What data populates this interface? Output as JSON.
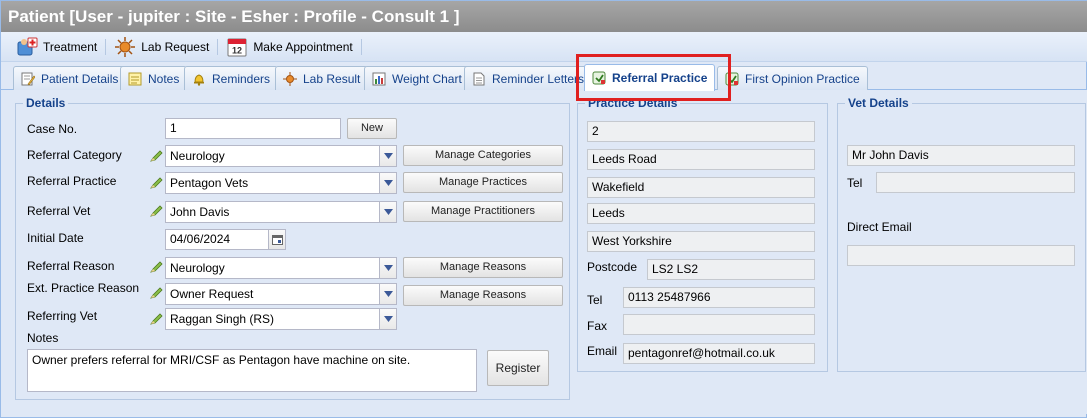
{
  "window": {
    "title": "Patient [User - jupiter : Site - Esher : Profile - Consult 1 ]"
  },
  "toolbar": {
    "treatment_label": "Treatment",
    "lab_request_label": "Lab Request",
    "make_appointment_label": "Make Appointment",
    "calendar_day": "12"
  },
  "tabs": {
    "patient_details": "Patient Details",
    "notes": "Notes",
    "reminders": "Reminders",
    "lab_result": "Lab Result",
    "weight_chart": "Weight Chart",
    "reminder_letters": "Reminder Letters",
    "referral_practice": "Referral Practice",
    "first_opinion_practice": "First Opinion Practice"
  },
  "details": {
    "legend": "Details",
    "case_no_label": "Case No.",
    "case_no_value": "1",
    "new_button": "New",
    "referral_category_label": "Referral Category",
    "referral_category_value": "Neurology",
    "manage_categories_button": "Manage Categories",
    "referral_practice_label": "Referral Practice",
    "referral_practice_value": "Pentagon Vets",
    "manage_practices_button": "Manage Practices",
    "referral_vet_label": "Referral Vet",
    "referral_vet_value": "John Davis",
    "manage_practitioners_button": "Manage Practitioners",
    "initial_date_label": "Initial Date",
    "initial_date_value": "04/06/2024",
    "referral_reason_label": "Referral Reason",
    "referral_reason_value": "Neurology",
    "manage_reasons_button_1": "Manage Reasons",
    "ext_practice_reason_label": "Ext. Practice Reason",
    "ext_practice_reason_value": "Owner Request",
    "manage_reasons_button_2": "Manage Reasons",
    "referring_vet_label": "Referring Vet",
    "referring_vet_value": "Raggan Singh (RS)",
    "notes_label": "Notes",
    "notes_value": "Owner prefers referral for MRI/CSF as Pentagon have machine on site.",
    "register_button": "Register"
  },
  "practice_details": {
    "legend": "Practice Details",
    "address_line1": "2",
    "address_line2": "Leeds Road",
    "address_line3": "Wakefield",
    "address_line4": "Leeds",
    "address_line5": "West Yorkshire",
    "postcode_label": "Postcode",
    "postcode_value": "LS2 LS2",
    "tel_label": "Tel",
    "tel_value": "0113 25487966",
    "fax_label": "Fax",
    "fax_value": "",
    "email_label": "Email",
    "email_value": "pentagonref@hotmail.co.uk"
  },
  "vet_details": {
    "legend": "Vet Details",
    "name_value": "Mr John Davis",
    "tel_label": "Tel",
    "tel_value": "",
    "direct_email_label": "Direct Email",
    "direct_email_value": ""
  },
  "colors": {
    "accent": "#15428b",
    "highlight": "#e02020",
    "title_bar": "#999999",
    "panel": "#dfe8f6"
  }
}
